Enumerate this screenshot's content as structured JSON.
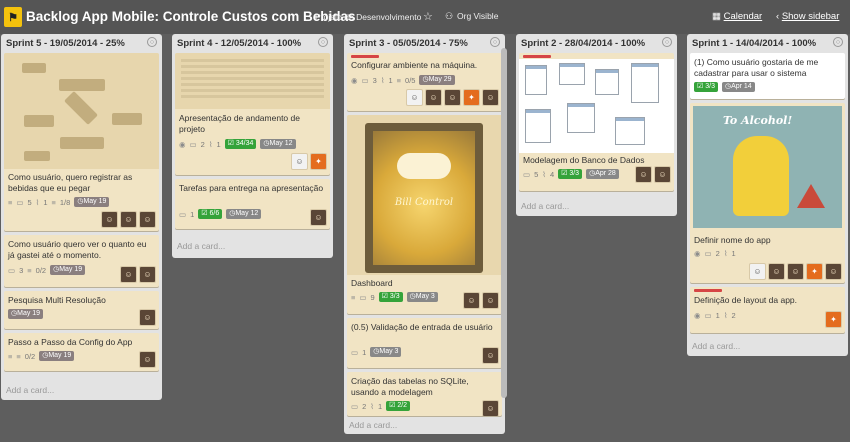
{
  "header": {
    "logo": "",
    "title": "Backlog App Mobile: Controle Custos com Bebidas",
    "org": "Projeto de Desenvolvimento",
    "star_icon": "☆",
    "visibility_icon": "org-icon",
    "visibility": "Org Visible",
    "calendar": "Calendar",
    "show_sidebar": "Show sidebar"
  },
  "lists": [
    {
      "title": "Sprint 5 - 19/05/2014 - 25%",
      "add_card": "Add a card...",
      "cards": [
        {
          "text": "Como usuário, quero registrar as bebidas que eu pegar",
          "comments": "5",
          "attachments": "1",
          "checklist": "1/8",
          "due": "May 19"
        },
        {
          "text": "Como usuário quero ver o quanto eu já gastei até o momento.",
          "comments": "3",
          "checklist": "0/2",
          "due": "May 19"
        },
        {
          "text": "Pesquisa Multi Resolução",
          "due": "May 19"
        },
        {
          "text": "Passo a Passo da Config do App",
          "checklist": "0/2",
          "due": "May 19"
        }
      ]
    },
    {
      "title": "Sprint 4 - 12/05/2014 - 100%",
      "add_card": "Add a card...",
      "cards": [
        {
          "text": "Apresentação de andamento de projeto",
          "comments": "2",
          "attachments": "1",
          "checklist": "34/34",
          "due": "May 12"
        },
        {
          "text": "Tarefas para entrega na apresentação",
          "comments": "1",
          "checklist": "6/6",
          "due": "May 12"
        }
      ]
    },
    {
      "title": "Sprint 3 - 05/05/2014 - 75%",
      "add_card": "Add a card...",
      "cards": [
        {
          "text": "Configurar ambiente na máquina.",
          "comments": "3",
          "attachments": "1",
          "checklist": "0/5",
          "due": "May 29"
        },
        {
          "text": "Dashboard",
          "comments": "9",
          "checklist": "3/3",
          "due": "May 3",
          "cover_text": "Bill Control"
        },
        {
          "text": "(0.5) Validação de entrada de usuário",
          "comments": "1",
          "due": "May 3"
        },
        {
          "text": "Criação das tabelas no SQLite, usando a modelagem",
          "comments": "2",
          "attachments": "1",
          "checklist": "2/2"
        }
      ]
    },
    {
      "title": "Sprint 2 - 28/04/2014 - 100%",
      "add_card": "Add a card...",
      "cards": [
        {
          "text": "Modelagem do Banco de Dados",
          "comments": "5",
          "attachments": "4",
          "checklist": "3/3",
          "due": "Apr 28"
        }
      ]
    },
    {
      "title": "Sprint 1 - 14/04/2014 - 100%",
      "add_card": "Add a card...",
      "cards": [
        {
          "text": "(1) Como usuário gostaria de me cadastrar para usar o sistema",
          "checklist": "3/3",
          "due": "Apr 14"
        },
        {
          "text": "Definir nome do app",
          "comments": "2",
          "attachments": "1",
          "cover_text": "To Alcohol!"
        },
        {
          "text": "Definição de layout da app.",
          "comments": "1",
          "attachments": "2"
        }
      ]
    }
  ],
  "icons": {
    "eye": "◉",
    "comment": "▭",
    "attach": "⌇",
    "checklist": "☑",
    "clock": "◷",
    "description": "≡"
  }
}
